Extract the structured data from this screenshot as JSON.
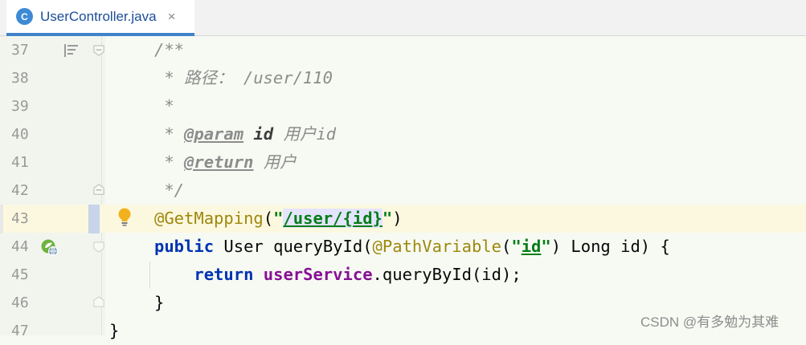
{
  "tab": {
    "title": "UserController.java",
    "icon_letter": "C",
    "close": "×"
  },
  "lines": [
    {
      "num": "37"
    },
    {
      "num": "38",
      "prefix": " * ",
      "text": "路径： /user/110"
    },
    {
      "num": "39",
      "text": " *"
    },
    {
      "num": "40",
      "prefix": " * ",
      "tag": "@param",
      "param": "id",
      "desc": "用户id"
    },
    {
      "num": "41",
      "prefix": " * ",
      "tag": "@return",
      "desc": "用户"
    },
    {
      "num": "42",
      "text": " */"
    },
    {
      "num": "43",
      "annotation": "@GetMapping",
      "open": "(",
      "q1": "\"",
      "path": "/user/{id}",
      "q2": "\"",
      "close": ")"
    },
    {
      "num": "44",
      "kw": "public",
      "mid": " User queryById(",
      "ann": "@PathVariable",
      "open": "(",
      "q1": "\"",
      "str": "id",
      "q2": "\"",
      "rest": ") Long id) {"
    },
    {
      "num": "45",
      "indent": "    ",
      "kw": "return",
      "sp": " ",
      "field": "userService",
      "rest": ".queryById(id);"
    },
    {
      "num": "46",
      "text": "}"
    },
    {
      "num": "47",
      "text": "}"
    }
  ],
  "doc_comment_open": "/**",
  "watermark": "CSDN @有多勉为其难",
  "colors": {
    "keyword": "#0033b3",
    "annotation": "#9e880d",
    "string": "#067d17",
    "field": "#871094",
    "comment": "#8c8c8c",
    "highlight_line": "#fcf8e0",
    "tab_underline": "#4083c9"
  },
  "icons": [
    "doc-comment-icon",
    "fold-icon",
    "intention-bulb-icon",
    "spring-web-endpoint-icon",
    "close-icon",
    "class-icon"
  ]
}
